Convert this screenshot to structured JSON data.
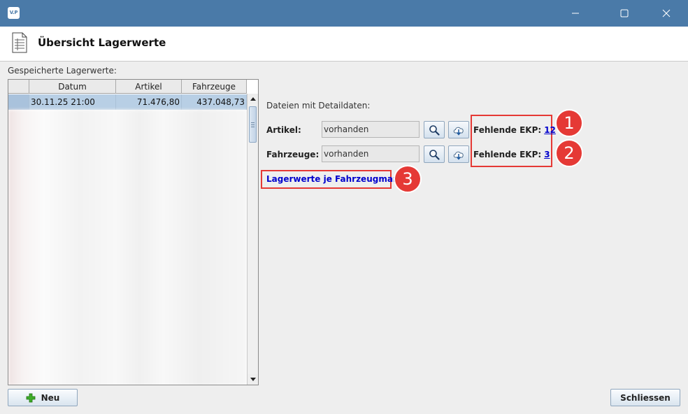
{
  "window": {
    "app_logo": "V.P",
    "controls": [
      "minimize-icon",
      "maximize-icon",
      "close-icon"
    ]
  },
  "header": {
    "title": "Übersicht Lagerwerte",
    "icon": "document-list-icon"
  },
  "gespeicherte": {
    "label": "Gespeicherte Lagerwerte:",
    "columns": [
      "Datum",
      "Artikel",
      "Fahrzeuge"
    ],
    "rows": [
      {
        "datum": "30.11.25 21:00",
        "artikel": "71.476,80",
        "fahrzeuge": "437.048,73"
      }
    ]
  },
  "details": {
    "heading": "Dateien mit Detaildaten:",
    "artikel": {
      "label": "Artikel:",
      "value": "vorhanden",
      "ekp_label": "Fehlende EKP:",
      "ekp_value": "12"
    },
    "fahrzeuge": {
      "label": "Fahrzeuge:",
      "value": "vorhanden",
      "ekp_label": "Fehlende EKP:",
      "ekp_value": "3"
    },
    "marke_link": "Lagerwerte je Fahrzeugmarke"
  },
  "annotations": [
    "1",
    "2",
    "3"
  ],
  "footer": {
    "neu_label": "Neu",
    "schliessen_label": "Schliessen"
  },
  "colors": {
    "titlebar": "#4a7aa8",
    "selection": "#b8cfe5",
    "link": "#0000cc",
    "highlight": "#e53935"
  }
}
